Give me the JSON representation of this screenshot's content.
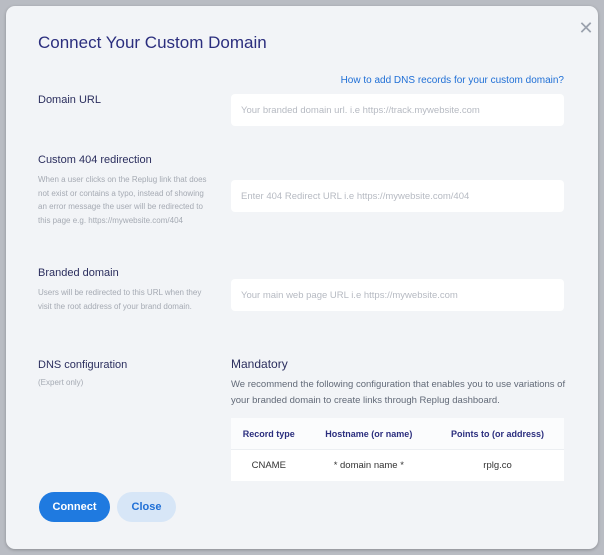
{
  "modal": {
    "title": "Connect Your Custom Domain",
    "help_link": "How to add DNS records for your custom domain?"
  },
  "domain_url": {
    "label": "Domain URL",
    "placeholder": "Your branded domain url. i.e https://track.mywebsite.com",
    "value": ""
  },
  "custom_404": {
    "label": "Custom 404 redirection",
    "description": "When a user clicks on the Replug link that does not exist or contains a typo, instead of showing an error message the user will be redirected to this page e.g. https://mywebsite.com/404",
    "placeholder": "Enter 404 Redirect URL i.e https://mywebsite.com/404",
    "value": ""
  },
  "branded_domain": {
    "label": "Branded domain",
    "description": "Users will be redirected to this URL when they visit the root address of your brand domain.",
    "placeholder": "Your main web page URL i.e https://mywebsite.com",
    "value": ""
  },
  "dns": {
    "label": "DNS configuration",
    "sublabel": "(Expert only)",
    "mandatory_title": "Mandatory",
    "recommendation": "We recommend the following configuration that enables you to use variations of your branded domain to create links through Replug dashboard.",
    "columns": [
      "Record type",
      "Hostname (or name)",
      "Points to (or address)"
    ],
    "rows": [
      [
        "CNAME",
        "* domain name *",
        "rplg.co"
      ]
    ]
  },
  "buttons": {
    "connect": "Connect",
    "close": "Close"
  },
  "colors": {
    "accent": "#1f7ae0",
    "title": "#2b2e7e",
    "panel": "#f2f4f7"
  }
}
